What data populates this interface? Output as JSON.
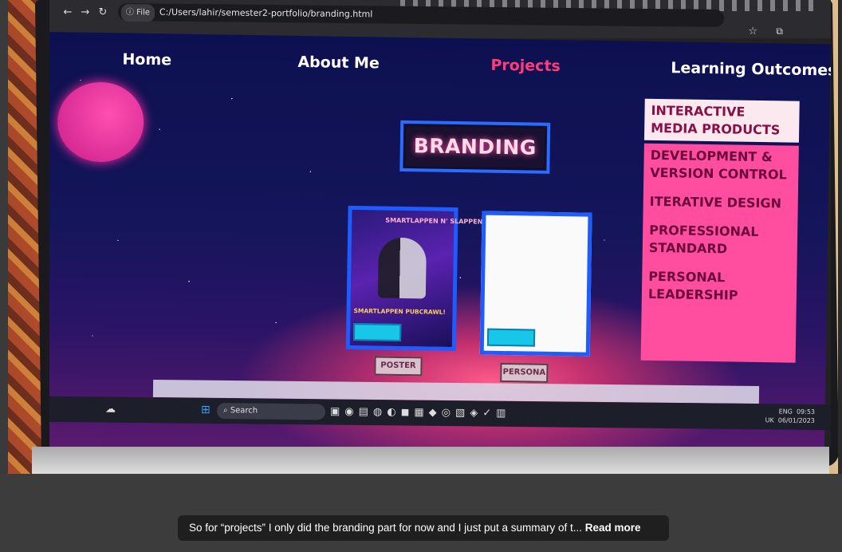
{
  "browser": {
    "url_prefix": "File",
    "url": "C:/Users/lahir/semester2-portfolio/branding.html"
  },
  "site": {
    "nav": [
      {
        "label": "Home"
      },
      {
        "label": "About Me"
      },
      {
        "label": "Projects"
      },
      {
        "label": "Learning Outcomes"
      }
    ],
    "active_nav": "Projects",
    "section_title": "BRANDING",
    "cards": [
      {
        "label": "POSTER",
        "poster_title": "SMARTLAPPEN N' SLAPPEN",
        "poster_subtitle": "SMARTLAPPEN PUBCRAWL!"
      },
      {
        "label": "PERSONA"
      }
    ],
    "learning_outcomes": [
      "INTERACTIVE MEDIA PRODUCTS",
      "DEVELOPMENT & VERSION CONTROL",
      "ITERATIVE DESIGN",
      "PROFESSIONAL STANDARD",
      "PERSONAL LEADERSHIP"
    ]
  },
  "taskbar": {
    "search_label": "Search",
    "lang": "ENG",
    "region": "UK",
    "time": "09:53",
    "date": "06/01/2023"
  },
  "caption": {
    "text": "So for “projects” I only did the branding part for now and I just put a summary of t...",
    "read_more": "Read more"
  },
  "colors": {
    "accent_pink": "#ff4da0",
    "active_nav": "#ff3c78",
    "card_border": "#1f5cff"
  }
}
